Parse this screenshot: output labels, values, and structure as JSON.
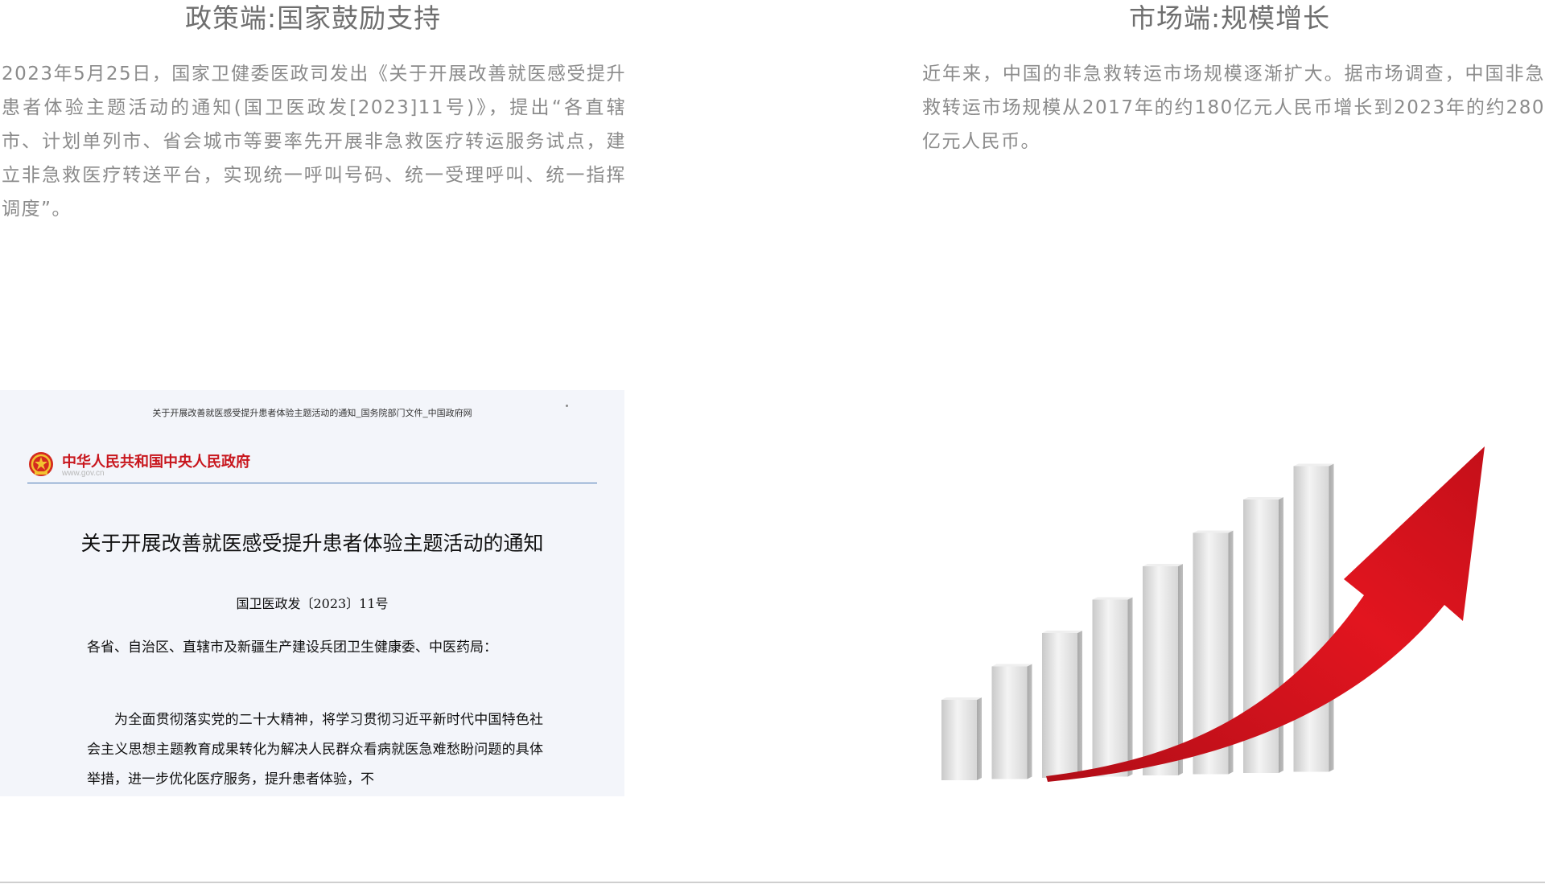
{
  "policy": {
    "title": "政策端:国家鼓励支持",
    "text": "2023年5月25日，国家卫健委医政司发出《关于开展改善就医感受提升患者体验主题活动的通知(国卫医政发[2023]11号)》，提出“各直辖市、计划单列市、省会城市等要率先开展非急救医疗转运服务试点，建立非急救医疗转送平台，实现统一呼叫号码、统一受理呼叫、统一指挥调度”。"
  },
  "market": {
    "title": "市场端:规模增长",
    "text": "近年来，中国的非急救转运市场规模逐渐扩大。据市场调查，中国非急救转运市场规模从2017年的约180亿元人民币增长到2023年的约280亿元人民币。"
  },
  "document_image": {
    "top_line": "关于开展改善就医感受提升患者体验主题活动的通知_国务院部门文件_中国政府网",
    "site_name": "中华人民共和国中央人民政府",
    "site_url": "www.gov.cn",
    "heading": "关于开展改善就医感受提升患者体验主题活动的通知",
    "doc_number": "国卫医政发〔2023〕11号",
    "salutation": "各省、自治区、直辖市及新疆生产建设兵团卫生健康委、中医药局：",
    "body": "为全面贯彻落实党的二十大精神，将学习贯彻习近平新时代中国特色社会主义思想主题教育成果转化为解决人民群众看病就医急难愁盼问题的具体举措，进一步优化医疗服务，提升患者体验，不",
    "colors": {
      "brand_red": "#c8161d",
      "rule_blue": "#4b7bb5"
    }
  },
  "growth_illustration": {
    "bar_levels": [
      0.25,
      0.35,
      0.45,
      0.55,
      0.65,
      0.75,
      0.85,
      0.95
    ],
    "colors": {
      "arrow": "#d8141f",
      "bar": "#e6e6e6"
    }
  }
}
